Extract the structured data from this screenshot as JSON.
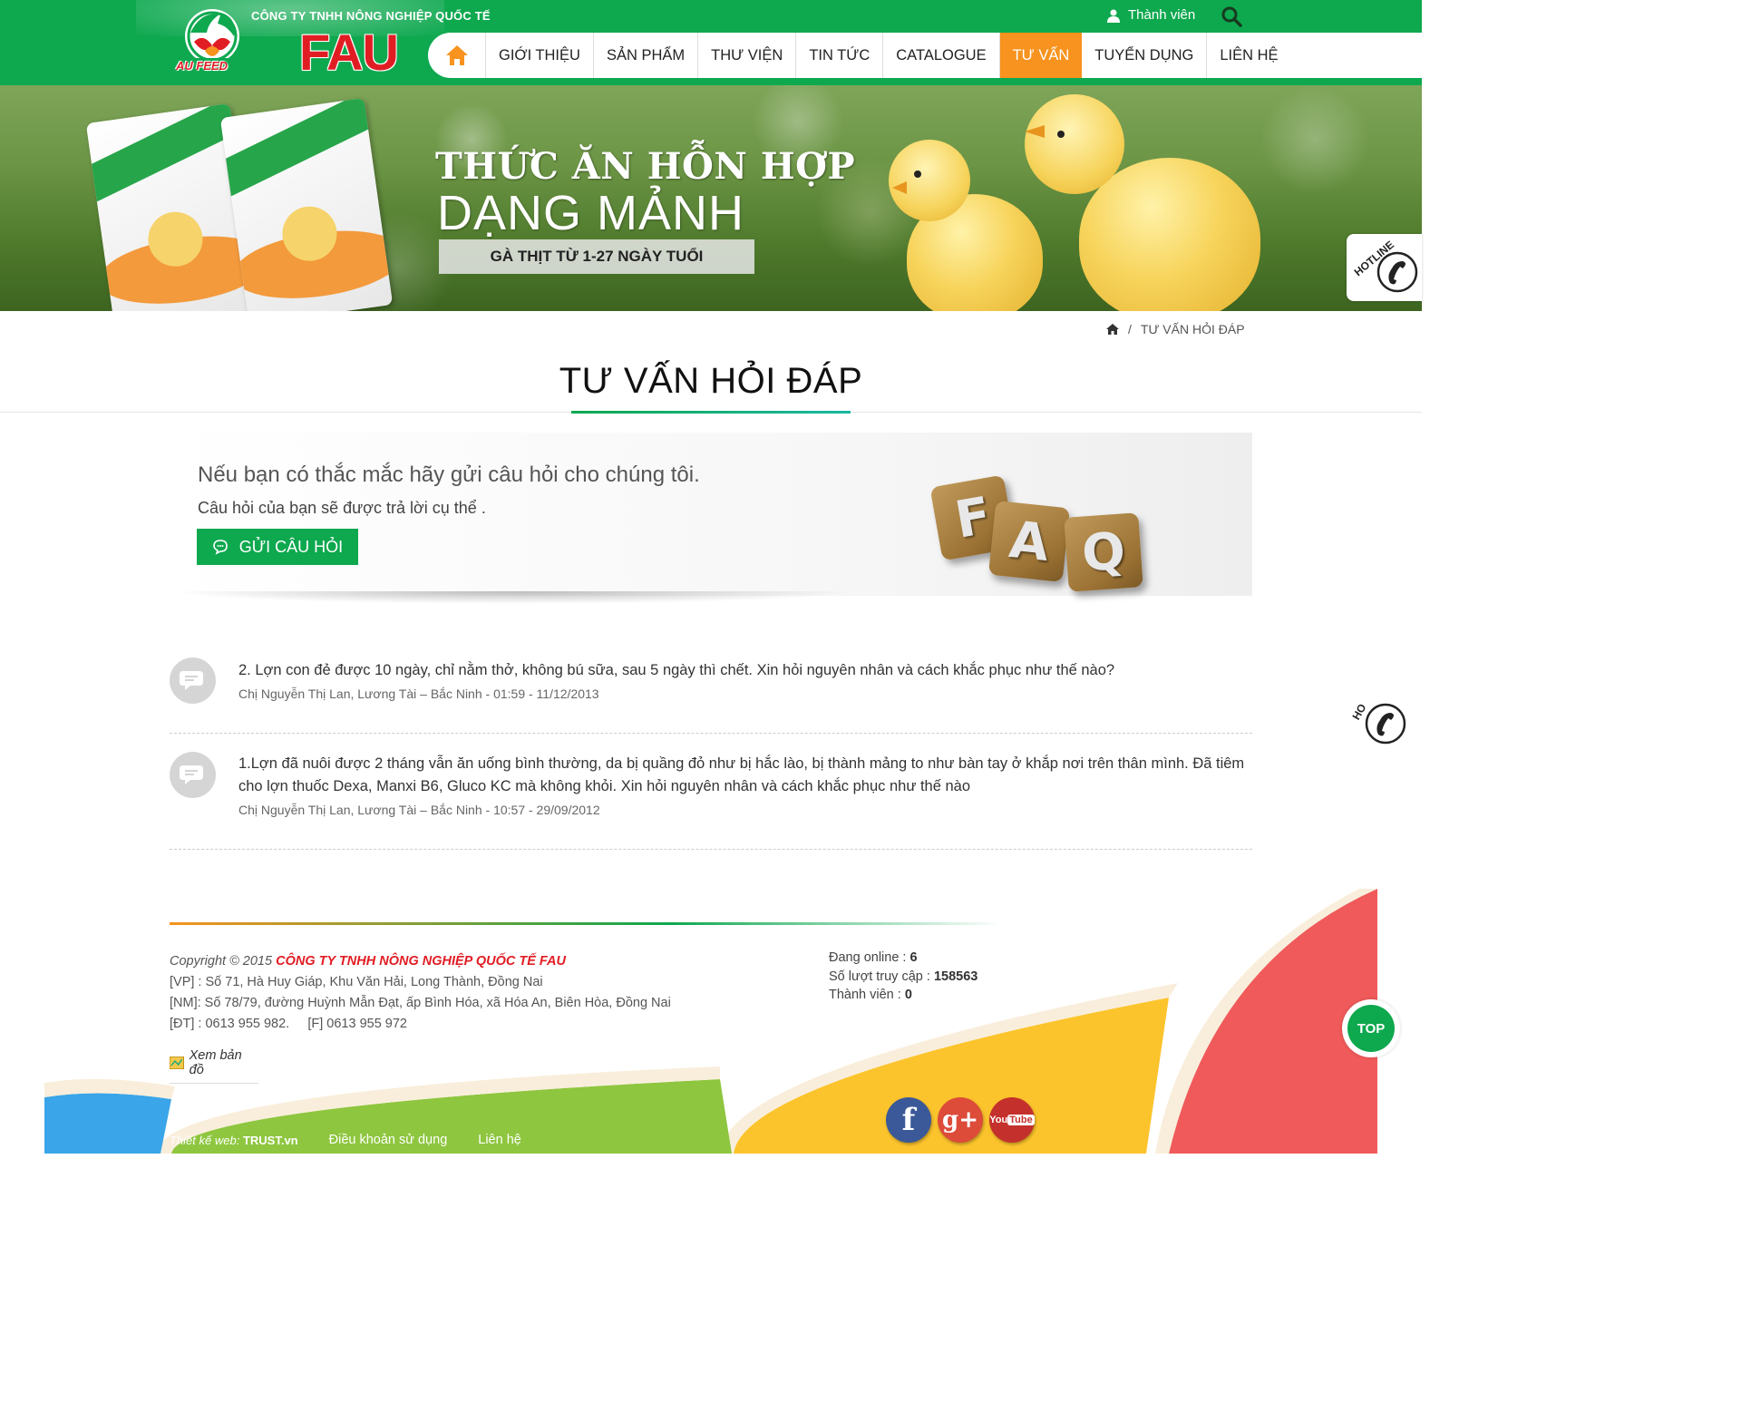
{
  "header": {
    "company_small": "CÔNG TY TNHH NÔNG NGHIỆP QUỐC TẾ",
    "brand": "FAU",
    "logo_text": "AU FEED",
    "member_label": "Thành viên"
  },
  "nav": {
    "items": [
      "GIỚI THIỆU",
      "SẢN PHẨM",
      "THƯ VIỆN",
      "TIN TỨC",
      "CATALOGUE",
      "TƯ VẤN",
      "TUYỂN DỤNG",
      "LIÊN HỆ"
    ],
    "active": "TƯ VẤN"
  },
  "banner": {
    "title1": "THỨC ĂN HỖN HỢP",
    "title2": "DẠNG MẢNH",
    "subtitle": "GÀ THỊT TỪ 1-27 NGÀY TUỔI"
  },
  "hotline": {
    "label": "HOTLINE",
    "label_short": "HO"
  },
  "breadcrumb": {
    "separator": "/",
    "current": "TƯ VẤN HỎI ĐÁP"
  },
  "page_title": "TƯ VẤN HỎI ĐÁP",
  "faq": {
    "heading": "Nếu bạn có thắc mắc hãy gửi câu hỏi cho chúng tôi.",
    "sub": "Câu hỏi của bạn sẽ được trả lời cụ thể .",
    "button_label": "GỬI CÂU HỎI",
    "tiles": [
      "F",
      "A",
      "Q"
    ]
  },
  "questions": [
    {
      "text": "2. Lợn con đẻ được 10 ngày, chỉ nằm thở, không bú sữa, sau 5 ngày thì chết. Xin hỏi nguyên nhân và cách khắc phục như thế nào?",
      "meta": "Chị Nguyễn Thị Lan, Lương Tài – Bắc Ninh - 01:59 - 11/12/2013"
    },
    {
      "text": "1.Lợn đã nuôi được 2 tháng vẫn ăn uống bình thường, da bị quầng đỏ như bị hắc lào, bị thành mảng to như bàn tay ở khắp nơi trên thân mình. Đã tiêm cho lợn thuốc Dexa, Manxi B6, Gluco KC mà không khỏi. Xin hỏi nguyên nhân và cách khắc phục như thế nào",
      "meta": "Chị Nguyễn Thị Lan, Lương Tài – Bắc Ninh - 10:57 - 29/09/2012"
    }
  ],
  "footer": {
    "copyright": "Copyright © 2015",
    "company": "CÔNG TY TNHH NÔNG NGHIỆP QUỐC TẾ FAU",
    "vp": "[VP] : Số 71, Hà Huy Giáp, Khu Văn Hải, Long Thành, Đồng Nai",
    "nm": "[NM]: Số 78/79, đường Huỳnh Mẫn Đạt, ấp Bình Hóa, xã Hóa An, Biên Hòa, Đồng Nai",
    "dt": "[ĐT] : 0613 955 982.",
    "fax": "[F] 0613 955 972",
    "map_link": "Xem bản đồ",
    "stats": {
      "online_label": "Đang online : ",
      "online_value": "6",
      "visits_label": "Số lượt truy cập : ",
      "visits_value": "158563",
      "members_label": "Thành viên : ",
      "members_value": "0"
    },
    "top_label": "TOP",
    "social": [
      "facebook-icon",
      "google-plus-icon",
      "youtube-icon"
    ],
    "designer_label": "Thiết kế web:",
    "designer_name": "TRUST.vn",
    "terms": "Điều khoản sử dụng",
    "contact": "Liên hệ"
  },
  "colors": {
    "brand_green": "#0ea84f",
    "accent_orange": "#f7931e",
    "brand_red": "#e11d24"
  }
}
